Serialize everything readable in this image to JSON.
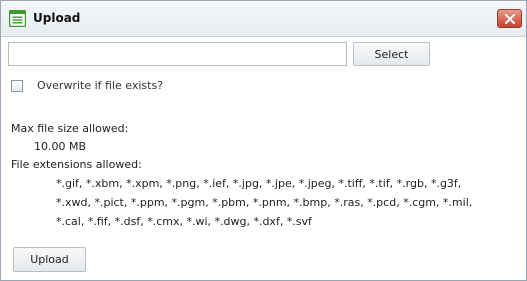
{
  "window": {
    "title": "Upload",
    "close_icon": "close-icon",
    "title_icon": "document-list-icon"
  },
  "file_picker": {
    "value": "",
    "placeholder": "",
    "select_label": "Select"
  },
  "overwrite": {
    "label": "Overwrite if file exists?",
    "checked": false
  },
  "limits": {
    "max_size_heading": "Max file size allowed:",
    "max_size_value": "10.00 MB",
    "extensions_heading": "File extensions allowed:",
    "extensions_lines": [
      "*.gif, *.xbm, *.xpm, *.png, *.ief, *.jpg, *.jpe, *.jpeg, *.tiff, *.tif, *.rgb, *.g3f,",
      "*.xwd, *.pict, *.ppm, *.pgm, *.pbm, *.pnm, *.bmp, *.ras, *.pcd, *.cgm, *.mil,",
      "*.cal, *.fif, *.dsf, *.cmx, *.wi, *.dwg, *.dxf, *.svf"
    ]
  },
  "actions": {
    "upload_label": "Upload"
  },
  "colors": {
    "title_icon_green": "#3f9a34",
    "close_red": "#c8452d"
  }
}
